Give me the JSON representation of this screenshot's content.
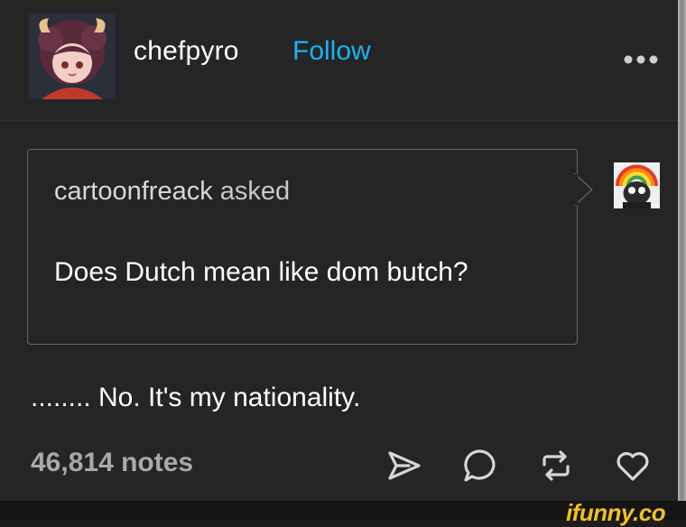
{
  "post": {
    "author": "chefpyro",
    "follow_label": "Follow",
    "ask": {
      "asker": "cartoonfreack",
      "asked_label": "asked",
      "question": "Does Dutch mean like dom butch?"
    },
    "answer": "........ No. It's my nationality.",
    "notes": "46,814 notes"
  },
  "icons": {
    "more": "more-dots-icon",
    "share": "share-send-icon",
    "reply": "reply-bubble-icon",
    "reblog": "reblog-icon",
    "like": "heart-icon"
  },
  "watermark": "ifunny.co",
  "colors": {
    "background": "#252525",
    "accent": "#1eb1f2",
    "muted_text": "#a9a9a9",
    "watermark": "#f2c21a"
  }
}
